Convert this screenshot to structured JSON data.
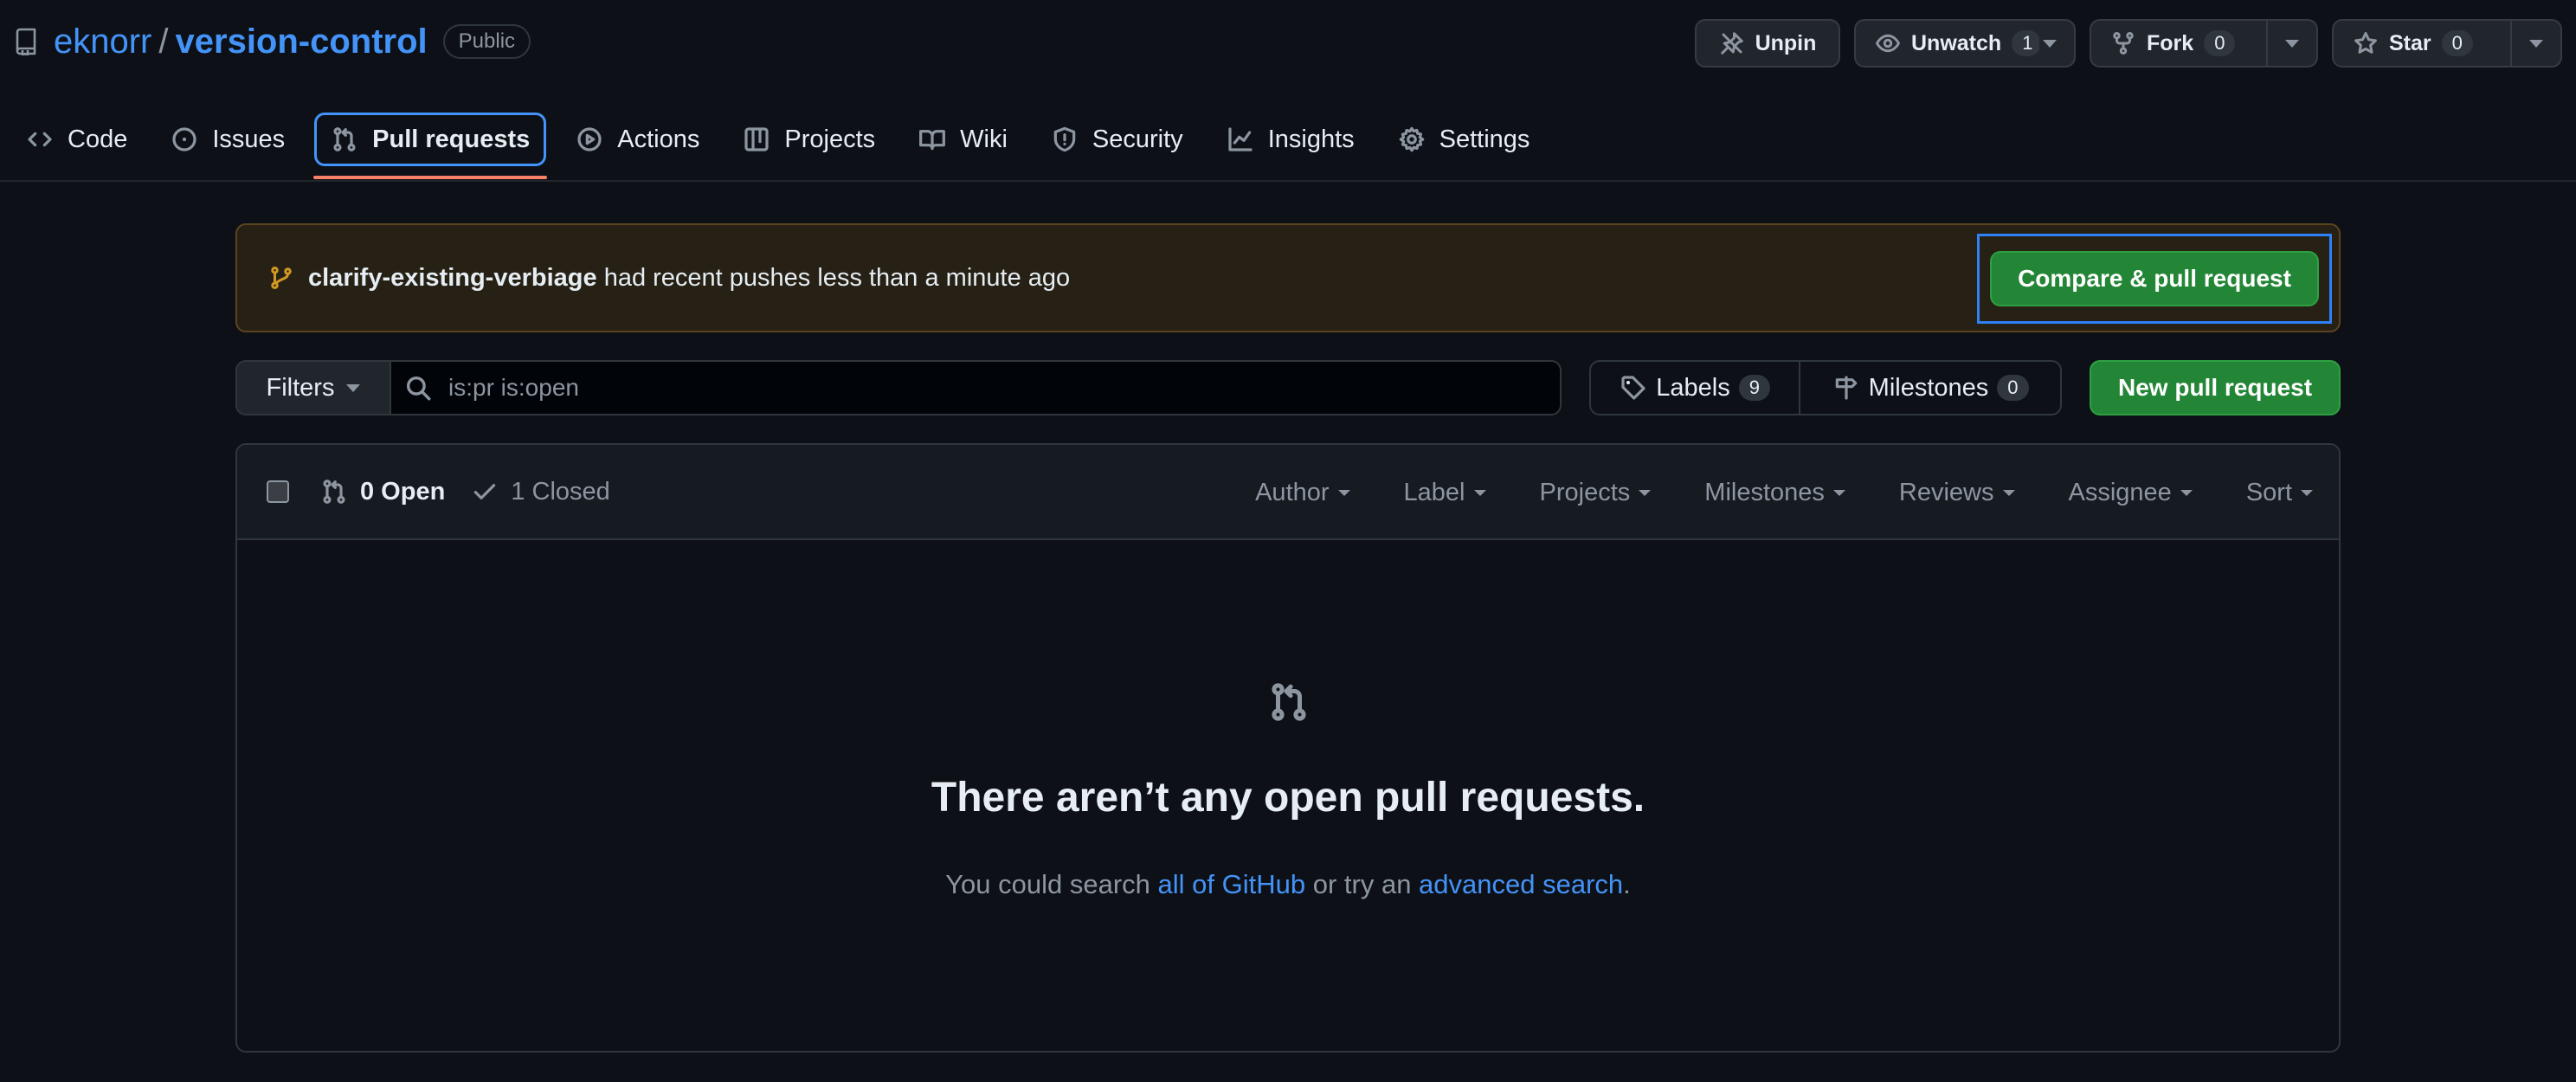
{
  "repo": {
    "owner": "eknorr",
    "separator": "/",
    "name": "version-control",
    "visibility": "Public"
  },
  "actions": {
    "unpin": "Unpin",
    "unwatch": {
      "label": "Unwatch",
      "count": "1"
    },
    "fork": {
      "label": "Fork",
      "count": "0"
    },
    "star": {
      "label": "Star",
      "count": "0"
    }
  },
  "nav": {
    "tabs": [
      {
        "label": "Code",
        "icon": "code-icon"
      },
      {
        "label": "Issues",
        "icon": "issue-opened-icon"
      },
      {
        "label": "Pull requests",
        "icon": "git-pull-request-icon",
        "selected": true
      },
      {
        "label": "Actions",
        "icon": "play-icon"
      },
      {
        "label": "Projects",
        "icon": "table-icon"
      },
      {
        "label": "Wiki",
        "icon": "book-icon"
      },
      {
        "label": "Security",
        "icon": "shield-icon"
      },
      {
        "label": "Insights",
        "icon": "graph-icon"
      },
      {
        "label": "Settings",
        "icon": "gear-icon"
      }
    ]
  },
  "banner": {
    "branch": "clarify-existing-verbiage",
    "message": " had recent pushes less than a minute ago",
    "compare_button": "Compare & pull request"
  },
  "filters": {
    "filters_label": "Filters",
    "search_value": "is:pr is:open",
    "labels": {
      "label": "Labels",
      "count": "9"
    },
    "milestones": {
      "label": "Milestones",
      "count": "0"
    },
    "new_pr": "New pull request"
  },
  "list": {
    "open": "0 Open",
    "closed": "1 Closed",
    "menus": [
      "Author",
      "Label",
      "Projects",
      "Milestones",
      "Reviews",
      "Assignee",
      "Sort"
    ]
  },
  "blankslate": {
    "heading": "There aren’t any open pull requests.",
    "sub_prefix": "You could search ",
    "link1": "all of GitHub",
    "sub_middle": " or try an ",
    "link2": "advanced search",
    "sub_suffix": "."
  },
  "colors": {
    "accent": "#4493f8",
    "success": "#238636",
    "tab_underline": "#f78166",
    "banner_icon": "#d29922"
  }
}
